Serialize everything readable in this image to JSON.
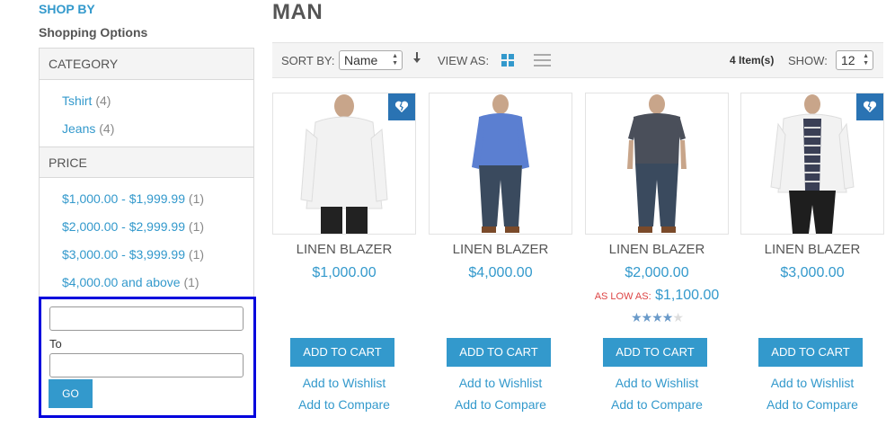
{
  "sidebar": {
    "shop_by": "SHOP BY",
    "shopping_options": "Shopping Options",
    "category": {
      "title": "CATEGORY",
      "items": [
        {
          "label": "Tshirt",
          "count": "(4)"
        },
        {
          "label": "Jeans",
          "count": "(4)"
        }
      ]
    },
    "price": {
      "title": "PRICE",
      "items": [
        {
          "label": "$1,000.00 - $1,999.99",
          "count": "(1)"
        },
        {
          "label": "$2,000.00 - $2,999.99",
          "count": "(1)"
        },
        {
          "label": "$3,000.00 - $3,999.99",
          "count": "(1)"
        },
        {
          "label": "$4,000.00 and above",
          "count": "(1)"
        }
      ],
      "range": {
        "from_value": "",
        "to_label": "To",
        "to_value": "",
        "go_label": "GO"
      }
    }
  },
  "main": {
    "title": "MAN",
    "toolbar": {
      "sort_label": "SORT BY:",
      "sort_value": "Name",
      "view_label": "VIEW AS:",
      "items_count": "4 Item(s)",
      "show_label": "SHOW:",
      "show_value": "12"
    },
    "products": [
      {
        "name": "LINEN BLAZER",
        "price": "$1,000.00",
        "cart": "ADD TO CART",
        "wishlist": "Add to Wishlist",
        "compare": "Add to Compare"
      },
      {
        "name": "LINEN BLAZER",
        "price": "$4,000.00",
        "cart": "ADD TO CART",
        "wishlist": "Add to Wishlist",
        "compare": "Add to Compare"
      },
      {
        "name": "LINEN BLAZER",
        "price": "$2,000.00",
        "as_low_label": "AS LOW AS:",
        "as_low_price": "$1,100.00",
        "rating": 3.5,
        "cart": "ADD TO CART",
        "wishlist": "Add to Wishlist",
        "compare": "Add to Compare"
      },
      {
        "name": "LINEN BLAZER",
        "price": "$3,000.00",
        "cart": "ADD TO CART",
        "wishlist": "Add to Wishlist",
        "compare": "Add to Compare"
      }
    ]
  },
  "colors": {
    "accent": "#3399cc",
    "badge": "#2a73b3",
    "highlight_border": "#0000dd",
    "sale_label": "#dd4444"
  },
  "icons": {
    "sort_direction": "arrow-down-icon",
    "grid_view": "grid-icon",
    "list_view": "list-icon",
    "wishlist_badge": "broken-heart-icon"
  }
}
